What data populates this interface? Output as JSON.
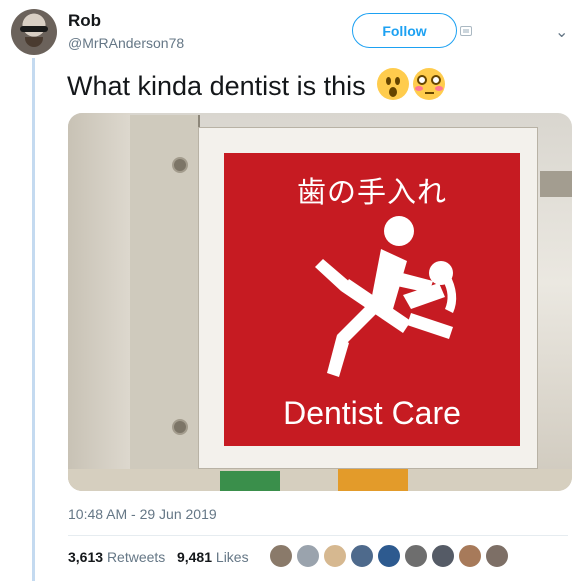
{
  "tweet": {
    "author_name": "Rob",
    "author_handle": "@MrRAnderson78",
    "follow_label": "Follow",
    "text": "What kinda dentist is this",
    "emojis": [
      "face-with-open-mouth",
      "flushed-face"
    ],
    "timestamp": "10:48 AM - 29 Jun 2019",
    "retweets_count": "3,613",
    "retweets_label": "Retweets",
    "likes_count": "9,481",
    "likes_label": "Likes"
  },
  "photo": {
    "sign_japanese": "歯の手入れ",
    "sign_english": "Dentist Care"
  },
  "colors": {
    "accent": "#1da1f2",
    "thread_line": "#c4daf0",
    "sign_red": "#c61b22",
    "liker_avatars": [
      "#8a7a6a",
      "#9aa3ad",
      "#d6b890",
      "#4e6a8c",
      "#2d5a8f",
      "#6e6e6e",
      "#555b66",
      "#a77a5a",
      "#7d6f66"
    ]
  }
}
